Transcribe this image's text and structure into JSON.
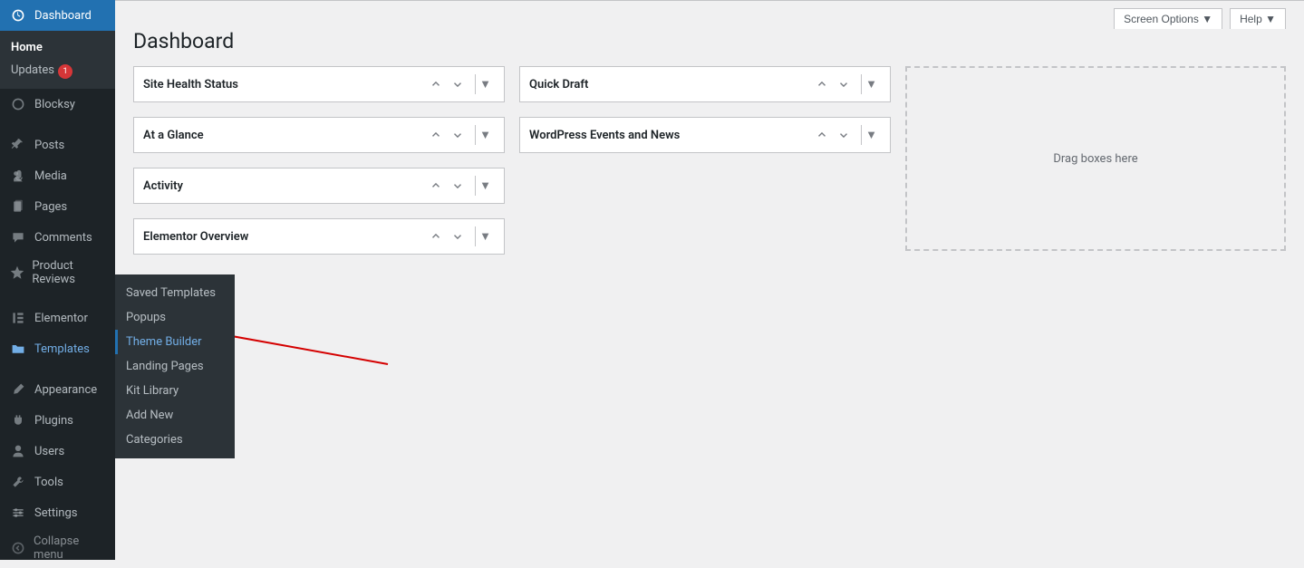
{
  "sidebar": {
    "items": [
      {
        "label": "Dashboard",
        "type": "current",
        "subitems": [
          {
            "label": "Home",
            "active": true
          },
          {
            "label": "Updates",
            "badge": "1"
          }
        ]
      },
      {
        "label": "Blocksy"
      },
      {
        "separator": true
      },
      {
        "label": "Posts"
      },
      {
        "label": "Media"
      },
      {
        "label": "Pages"
      },
      {
        "label": "Comments"
      },
      {
        "label": "Product Reviews"
      },
      {
        "separator": true
      },
      {
        "label": "Elementor"
      },
      {
        "label": "Templates",
        "type": "open"
      },
      {
        "separator": true
      },
      {
        "label": "Appearance"
      },
      {
        "label": "Plugins"
      },
      {
        "label": "Users"
      },
      {
        "label": "Tools"
      },
      {
        "label": "Settings"
      },
      {
        "label": "Collapse menu",
        "collapse": true
      }
    ]
  },
  "flyout": {
    "items": [
      {
        "label": "Saved Templates"
      },
      {
        "label": "Popups"
      },
      {
        "label": "Theme Builder",
        "highlight": true
      },
      {
        "label": "Landing Pages"
      },
      {
        "label": "Kit Library"
      },
      {
        "label": "Add New"
      },
      {
        "label": "Categories"
      }
    ]
  },
  "page": {
    "title": "Dashboard",
    "screen_options": "Screen Options",
    "help": "Help",
    "dropzone_text": "Drag boxes here"
  },
  "widgets": {
    "col1": [
      {
        "title": "Site Health Status"
      },
      {
        "title": "At a Glance"
      },
      {
        "title": "Activity"
      },
      {
        "title": "Elementor Overview"
      }
    ],
    "col2": [
      {
        "title": "Quick Draft"
      },
      {
        "title": "WordPress Events and News"
      }
    ]
  }
}
